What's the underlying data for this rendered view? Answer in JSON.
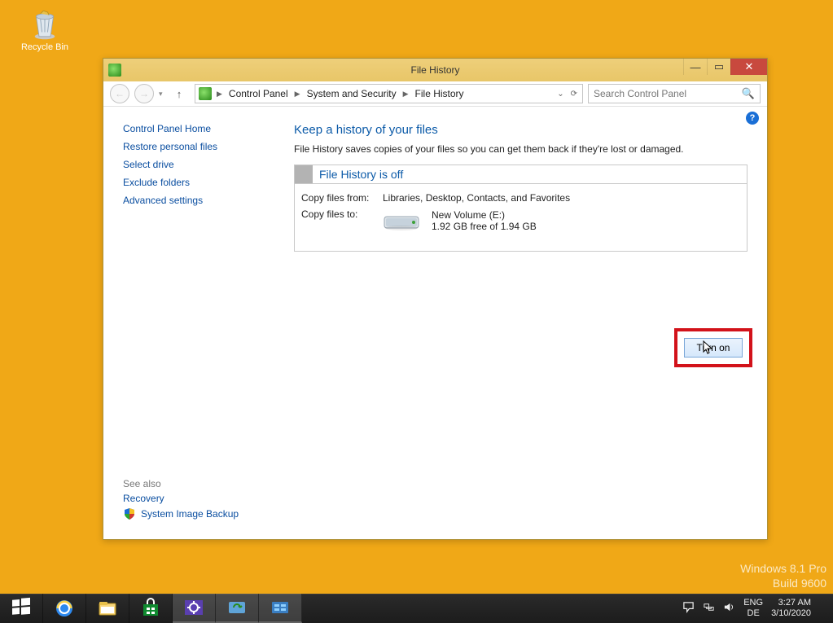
{
  "desktop": {
    "recycle_bin_label": "Recycle Bin"
  },
  "window": {
    "title": "File History",
    "breadcrumb": {
      "items": [
        "Control Panel",
        "System and Security",
        "File History"
      ]
    },
    "search_placeholder": "Search Control Panel"
  },
  "sidebar": {
    "home": "Control Panel Home",
    "links": [
      "Restore personal files",
      "Select drive",
      "Exclude folders",
      "Advanced settings"
    ],
    "see_also_label": "See also",
    "see_also": [
      "Recovery",
      "System Image Backup"
    ]
  },
  "content": {
    "heading": "Keep a history of your files",
    "description": "File History saves copies of your files so you can get them back if they're lost or damaged.",
    "status_title": "File History is off",
    "copy_from_label": "Copy files from:",
    "copy_from_value": "Libraries, Desktop, Contacts, and Favorites",
    "copy_to_label": "Copy files to:",
    "drive_name": "New Volume (E:)",
    "drive_space": "1.92 GB free of 1.94 GB",
    "turn_on_label": "Turn on"
  },
  "watermark": {
    "line1": "Windows 8.1 Pro",
    "line2": "Build 9600"
  },
  "tray": {
    "lang1": "ENG",
    "lang2": "DE",
    "time": "3:27 AM",
    "date": "3/10/2020"
  }
}
